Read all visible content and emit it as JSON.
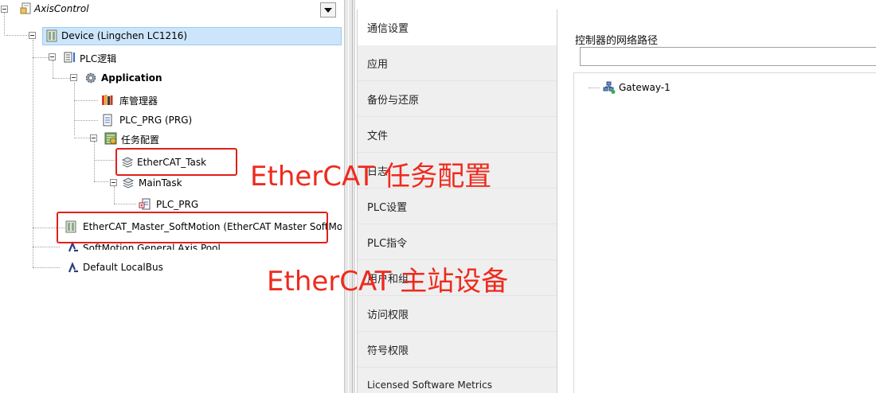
{
  "tree": {
    "root": "AxisControl",
    "device": "Device (Lingchen LC1216)",
    "plc_logic": "PLC逻辑",
    "application": "Application",
    "library_manager": "库管理器",
    "plc_prg": "PLC_PRG (PRG)",
    "task_config": "任务配置",
    "ethercat_task": "EtherCAT_Task",
    "main_task": "MainTask",
    "plc_prg_call": "PLC_PRG",
    "ethercat_master": "EtherCAT_Master_SoftMotion (EtherCAT Master SoftMotion)",
    "softmotion_pool": "SoftMotion General Axis Pool",
    "local_bus": "Default LocalBus"
  },
  "annotations": {
    "task_label": "EtherCAT 任务配置",
    "master_label": "EtherCAT 主站设备",
    "color": "#ef2a1e"
  },
  "tabs": [
    {
      "label": "通信设置",
      "active": true
    },
    {
      "label": "应用"
    },
    {
      "label": "备份与还原"
    },
    {
      "label": "文件"
    },
    {
      "label": "日志"
    },
    {
      "label": "PLC设置"
    },
    {
      "label": "PLC指令"
    },
    {
      "label": "用户和组"
    },
    {
      "label": "访问权限"
    },
    {
      "label": "符号权限"
    },
    {
      "label": "Licensed Software Metrics"
    }
  ],
  "comm": {
    "title": "控制器的网络路径",
    "path_value": "",
    "gateway": "Gateway-1"
  },
  "colors": {
    "selection": "#cde5fb",
    "tab_bg": "#efefef",
    "highlight_box": "#e0201a"
  }
}
